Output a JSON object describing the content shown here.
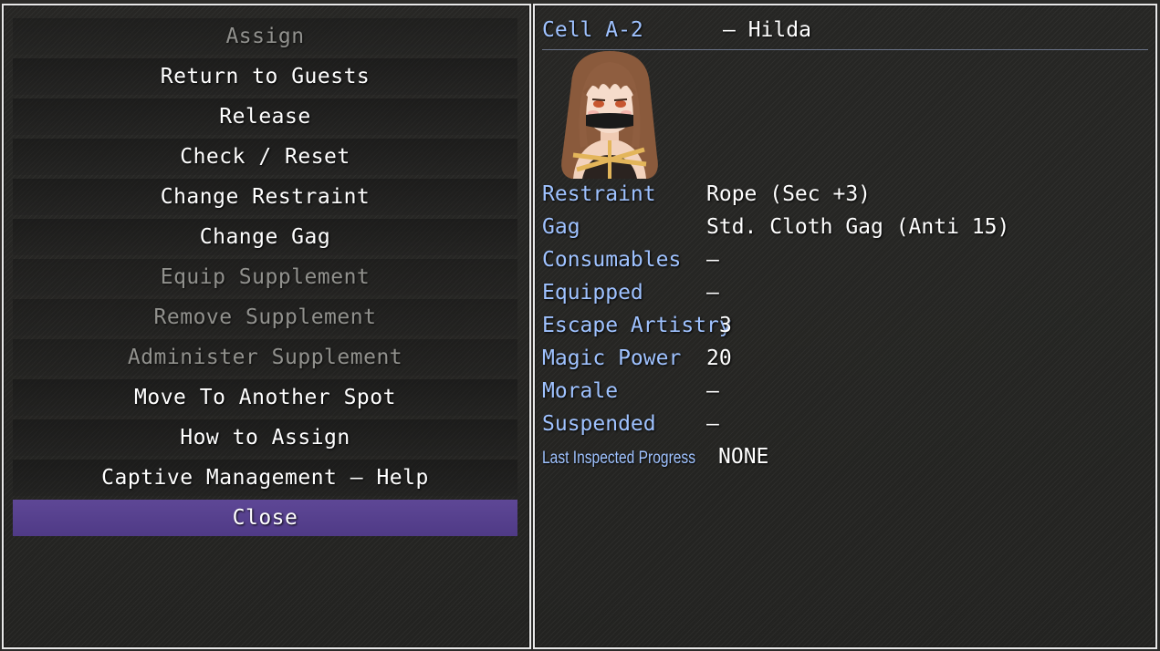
{
  "menu": {
    "items": [
      {
        "label": "Assign",
        "enabled": false
      },
      {
        "label": "Return to Guests",
        "enabled": true
      },
      {
        "label": "Release",
        "enabled": true
      },
      {
        "label": "Check / Reset",
        "enabled": true
      },
      {
        "label": "Change Restraint",
        "enabled": true
      },
      {
        "label": "Change Gag",
        "enabled": true
      },
      {
        "label": "Equip Supplement",
        "enabled": false
      },
      {
        "label": "Remove Supplement",
        "enabled": false
      },
      {
        "label": "Administer Supplement",
        "enabled": false
      },
      {
        "label": "Move To Another Spot",
        "enabled": true
      },
      {
        "label": "How to Assign",
        "enabled": true
      },
      {
        "label": "Captive Management — Help",
        "enabled": true
      },
      {
        "label": "Close",
        "enabled": true,
        "selected": true
      }
    ],
    "highlight_color": "#5e4796"
  },
  "status": {
    "cell": "Cell A-2",
    "name": "— Hilda",
    "portrait": "captive-portrait-hilda",
    "rows": [
      {
        "label": "Restraint",
        "value": "Rope (Sec +3)"
      },
      {
        "label": "Gag",
        "value": "Std. Cloth Gag (Anti 15)"
      },
      {
        "label": "Consumables",
        "value": "—"
      },
      {
        "label": "Equipped",
        "value": "—"
      },
      {
        "label": "Escape Artistry",
        "value": "3"
      },
      {
        "label": "Magic Power",
        "value": "20"
      },
      {
        "label": "Morale",
        "value": "—"
      },
      {
        "label": "Suspended",
        "value": "—"
      },
      {
        "label": "Last Inspected Progress",
        "value": "NONE"
      }
    ],
    "label_color": "#9fc2ff"
  }
}
